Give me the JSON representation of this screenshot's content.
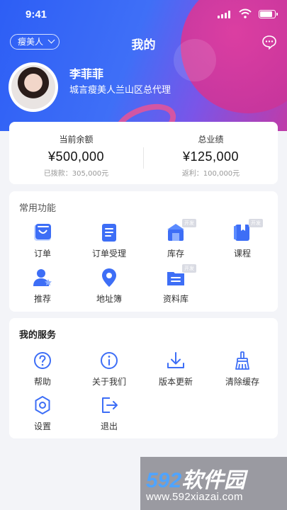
{
  "status_bar": {
    "time": "9:41"
  },
  "header": {
    "brand_selector": "瘦美人",
    "title": "我的",
    "user_name": "李菲菲",
    "user_title": "城言瘦美人兰山区总代理"
  },
  "balance": {
    "left": {
      "label": "当前余额",
      "amount": "¥500,000",
      "sub": "已拨款：305,000元"
    },
    "right": {
      "label": "总业绩",
      "amount": "¥125,000",
      "sub": "返利：100,000元"
    }
  },
  "common_functions": {
    "title": "常用功能",
    "items": [
      {
        "label": "订单",
        "icon": "order-icon",
        "badge": ""
      },
      {
        "label": "订单受理",
        "icon": "order-accept-icon",
        "badge": ""
      },
      {
        "label": "库存",
        "icon": "inventory-icon",
        "badge": "开发"
      },
      {
        "label": "课程",
        "icon": "course-icon",
        "badge": "开发"
      },
      {
        "label": "推荐",
        "icon": "recommend-icon",
        "badge": ""
      },
      {
        "label": "地址簿",
        "icon": "address-book-icon",
        "badge": ""
      },
      {
        "label": "资料库",
        "icon": "library-icon",
        "badge": "开发"
      }
    ]
  },
  "my_services": {
    "title": "我的服务",
    "items": [
      {
        "label": "帮助",
        "icon": "help-icon"
      },
      {
        "label": "关于我们",
        "icon": "info-icon"
      },
      {
        "label": "版本更新",
        "icon": "download-icon"
      },
      {
        "label": "清除缓存",
        "icon": "broom-icon"
      },
      {
        "label": "设置",
        "icon": "settings-icon"
      },
      {
        "label": "退出",
        "icon": "logout-icon"
      }
    ]
  },
  "watermark": {
    "logo_num": "592",
    "logo_text": "软件园",
    "url": "www.592xiazai.com"
  },
  "colors": {
    "accent": "#3d6ef6",
    "header_pink": "#d4389f",
    "card_bg": "#ffffff",
    "page_bg": "#f3f4f8"
  }
}
